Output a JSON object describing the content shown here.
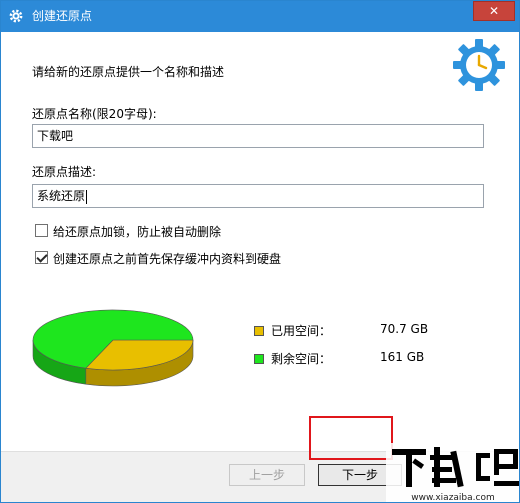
{
  "window": {
    "title": "创建还原点",
    "close_glyph": "✕"
  },
  "header": {
    "instruction": "请给新的还原点提供一个名称和描述",
    "icon": "gear-clock-icon"
  },
  "form": {
    "name_label": "还原点名称(限20字母):",
    "name_value": "下载吧",
    "desc_label": "还原点描述:",
    "desc_value": "系统还原",
    "lock_checkbox": {
      "label": "给还原点加锁，防止被自动删除",
      "checked": false
    },
    "flush_checkbox": {
      "label": "创建还原点之前首先保存缓冲内资料到硬盘",
      "checked": true
    }
  },
  "disk_usage": {
    "used": {
      "label": "已用空间：",
      "value": "70.7 GB",
      "color": "#e8bf00",
      "amount_gb": 70.7
    },
    "free": {
      "label": "剩余空间：",
      "value": "161 GB",
      "color": "#1ee61e",
      "amount_gb": 161
    }
  },
  "buttons": {
    "prev_label": "上一步",
    "next_label": "下一步"
  },
  "watermark": {
    "brand": "下载吧",
    "url": "www.xiazaiba.com"
  }
}
